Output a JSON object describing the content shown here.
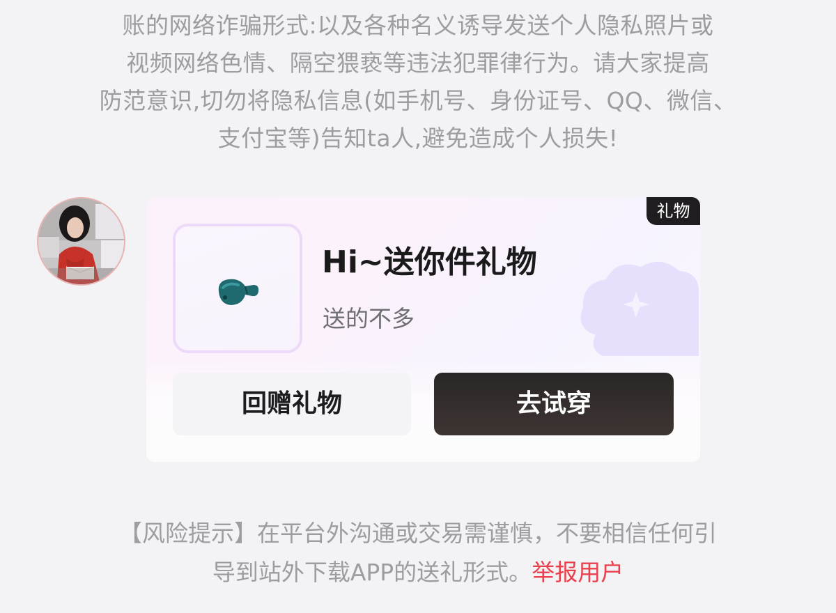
{
  "top_notice": {
    "lines": [
      "账的网络诈骗形式:以及各种名义诱导发送个人隐私照片或",
      "视频网络色情、隔空猥亵等违法犯罪律行为。请大家提高",
      "防范意识,切勿将隐私信息(如手机号、身份证号、QQ、微信、",
      "支付宝等)告知ta人,避免造成个人损失!"
    ]
  },
  "gift_card": {
    "tag": "礼物",
    "title": "Hi~送你件礼物",
    "subtitle": "送的不多",
    "return_button": "回赠礼物",
    "try_button": "去试穿"
  },
  "bottom_notice": {
    "line1": "【风险提示】在平台外沟通或交易需谨慎，不要相信任何引",
    "line2": "导到站外下载APP的送礼形式。",
    "report_link": "举报用户"
  },
  "colors": {
    "background": "#f3f2f4",
    "notice_text": "#9d9d9f",
    "report_red": "#ea3f4c",
    "dark_button": "#2a2627",
    "tag_bg": "#1f1d20"
  }
}
